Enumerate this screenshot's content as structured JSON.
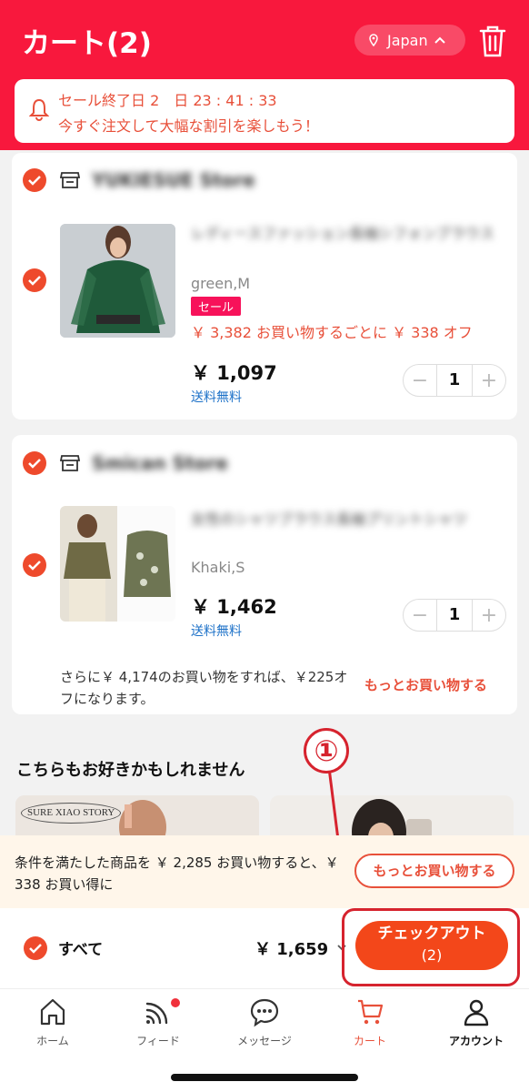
{
  "header": {
    "title": "カート(2)",
    "country": "Japan"
  },
  "sale_banner": {
    "line1": "セール終了日 2　日 23 : 41 : 33",
    "line2": "今すぐ注文して大幅な割引を楽しもう！"
  },
  "stores": [
    {
      "name": "YUKIESUE Store",
      "item": {
        "title_blurred": "レディースファッション長袖シフォンブラウス",
        "variant": "green,M",
        "sale_tag": "セール",
        "promo": "￥ 3,382 お買い物するごとに ￥ 338 オフ",
        "price": "￥ 1,097",
        "shipping": "送料無料",
        "qty": "1"
      }
    },
    {
      "name": "Smican Store",
      "item": {
        "title_blurred": "女性のシャツブラウス長袖プリントシャツ",
        "variant": "Khaki,S",
        "price": "￥ 1,462",
        "shipping": "送料無料",
        "qty": "1"
      },
      "more_note": "さらに￥ 4,174のお買い物をすれば、￥225オフになります。",
      "more_link": "もっとお買い物する"
    }
  ],
  "recommend": {
    "title": "こちらもお好きかもしれません",
    "brand_logo": "SURE XIAO STORY"
  },
  "condition_bar": {
    "text": "条件を満たした商品を ￥ 2,285 お買い物すると、￥ 338 お買い得に",
    "button": "もっとお買い物する"
  },
  "checkout": {
    "all_label": "すべて",
    "total": "￥ 1,659",
    "button_line1": "チェックアウト",
    "button_line2": "(2)"
  },
  "annotation": {
    "number": "①",
    "color": "#d6232e"
  },
  "tabs": [
    {
      "label": "ホーム",
      "icon": "home-icon"
    },
    {
      "label": "フィード",
      "icon": "feed-icon"
    },
    {
      "label": "メッセージ",
      "icon": "message-icon"
    },
    {
      "label": "カート",
      "icon": "cart-icon"
    },
    {
      "label": "アカウント",
      "icon": "account-icon"
    }
  ],
  "colors": {
    "brand": "#f8183d",
    "accent": "#ee4a2c",
    "link": "#1e72c8"
  }
}
